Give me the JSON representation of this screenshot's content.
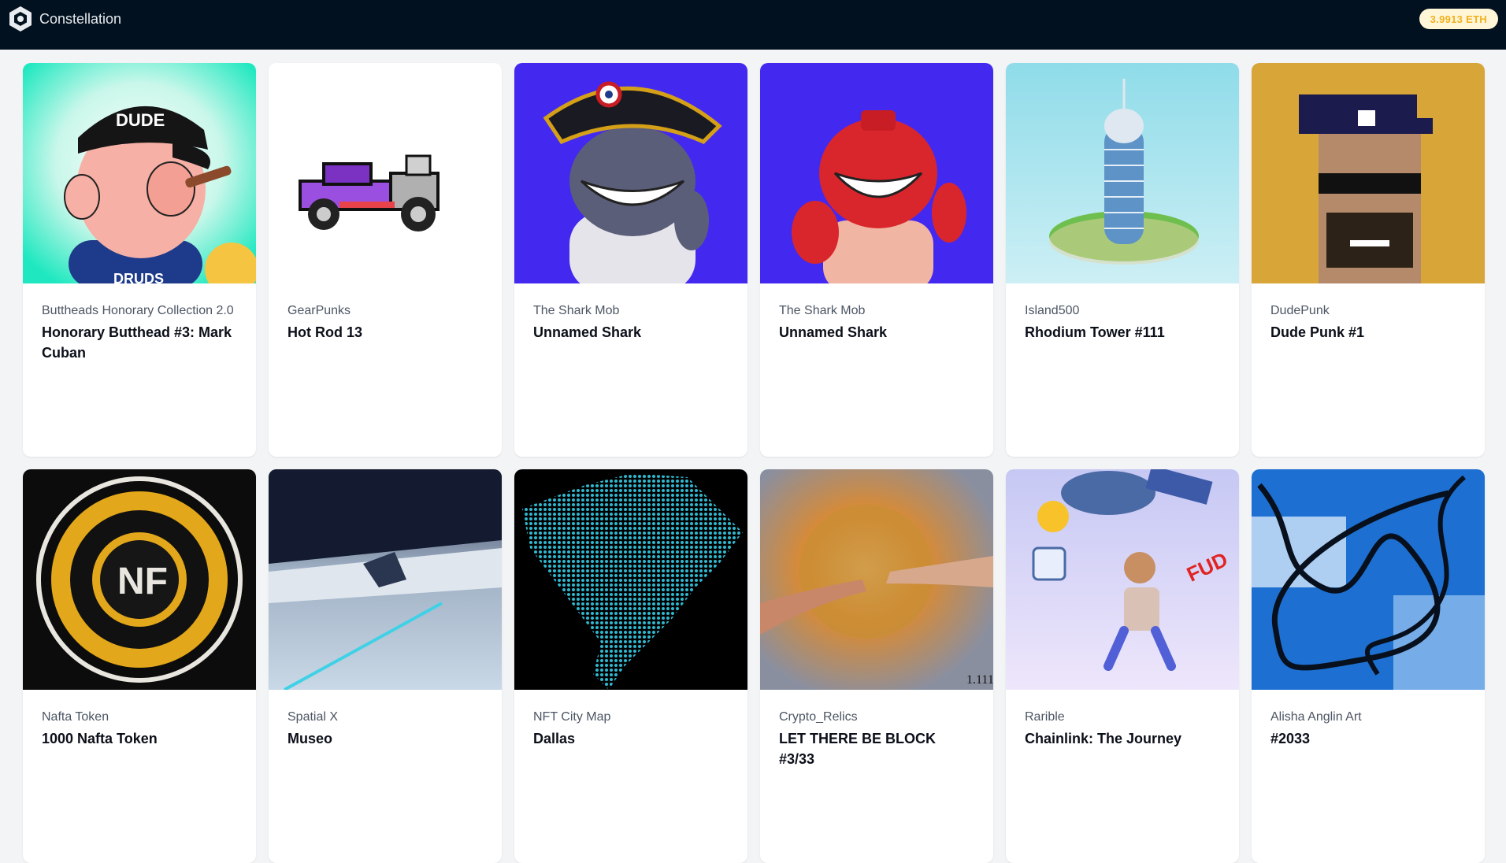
{
  "header": {
    "app_name": "Constellation",
    "balance": "3.9913 ETH"
  },
  "cards": [
    {
      "collection": "Buttheads Honorary Collection 2.0",
      "title": "Honorary Butthead #3: Mark Cuban",
      "art": "cartoon-butthead"
    },
    {
      "collection": "GearPunks",
      "title": "Hot Rod 13",
      "art": "pixel-hot-rod"
    },
    {
      "collection": "The Shark Mob",
      "title": "Unnamed Shark",
      "art": "shark-admiral"
    },
    {
      "collection": "The Shark Mob",
      "title": "Unnamed Shark",
      "art": "shark-red"
    },
    {
      "collection": "Island500",
      "title": "Rhodium Tower #111",
      "art": "island-tower"
    },
    {
      "collection": "DudePunk",
      "title": "Dude Punk #1",
      "art": "pixel-punk"
    },
    {
      "collection": "Nafta Token",
      "title": "1000 Nafta Token",
      "art": "gold-coin"
    },
    {
      "collection": "Spatial X",
      "title": "Museo",
      "art": "gallery-room"
    },
    {
      "collection": "NFT City Map",
      "title": "Dallas",
      "art": "dot-map"
    },
    {
      "collection": "Crypto_Relics",
      "title": "LET THERE BE BLOCK #3/33",
      "art": "bitcoin-creation"
    },
    {
      "collection": "Rarible",
      "title": "Chainlink: The Journey",
      "art": "rarible-journey"
    },
    {
      "collection": "Alisha Anglin Art",
      "title": "#2033",
      "art": "blue-abstract"
    }
  ],
  "colors": {
    "header_bg": "#02111f",
    "balance_text": "#f2b01e",
    "balance_bg": "#fff6d8",
    "page_bg": "#f3f4f6"
  }
}
